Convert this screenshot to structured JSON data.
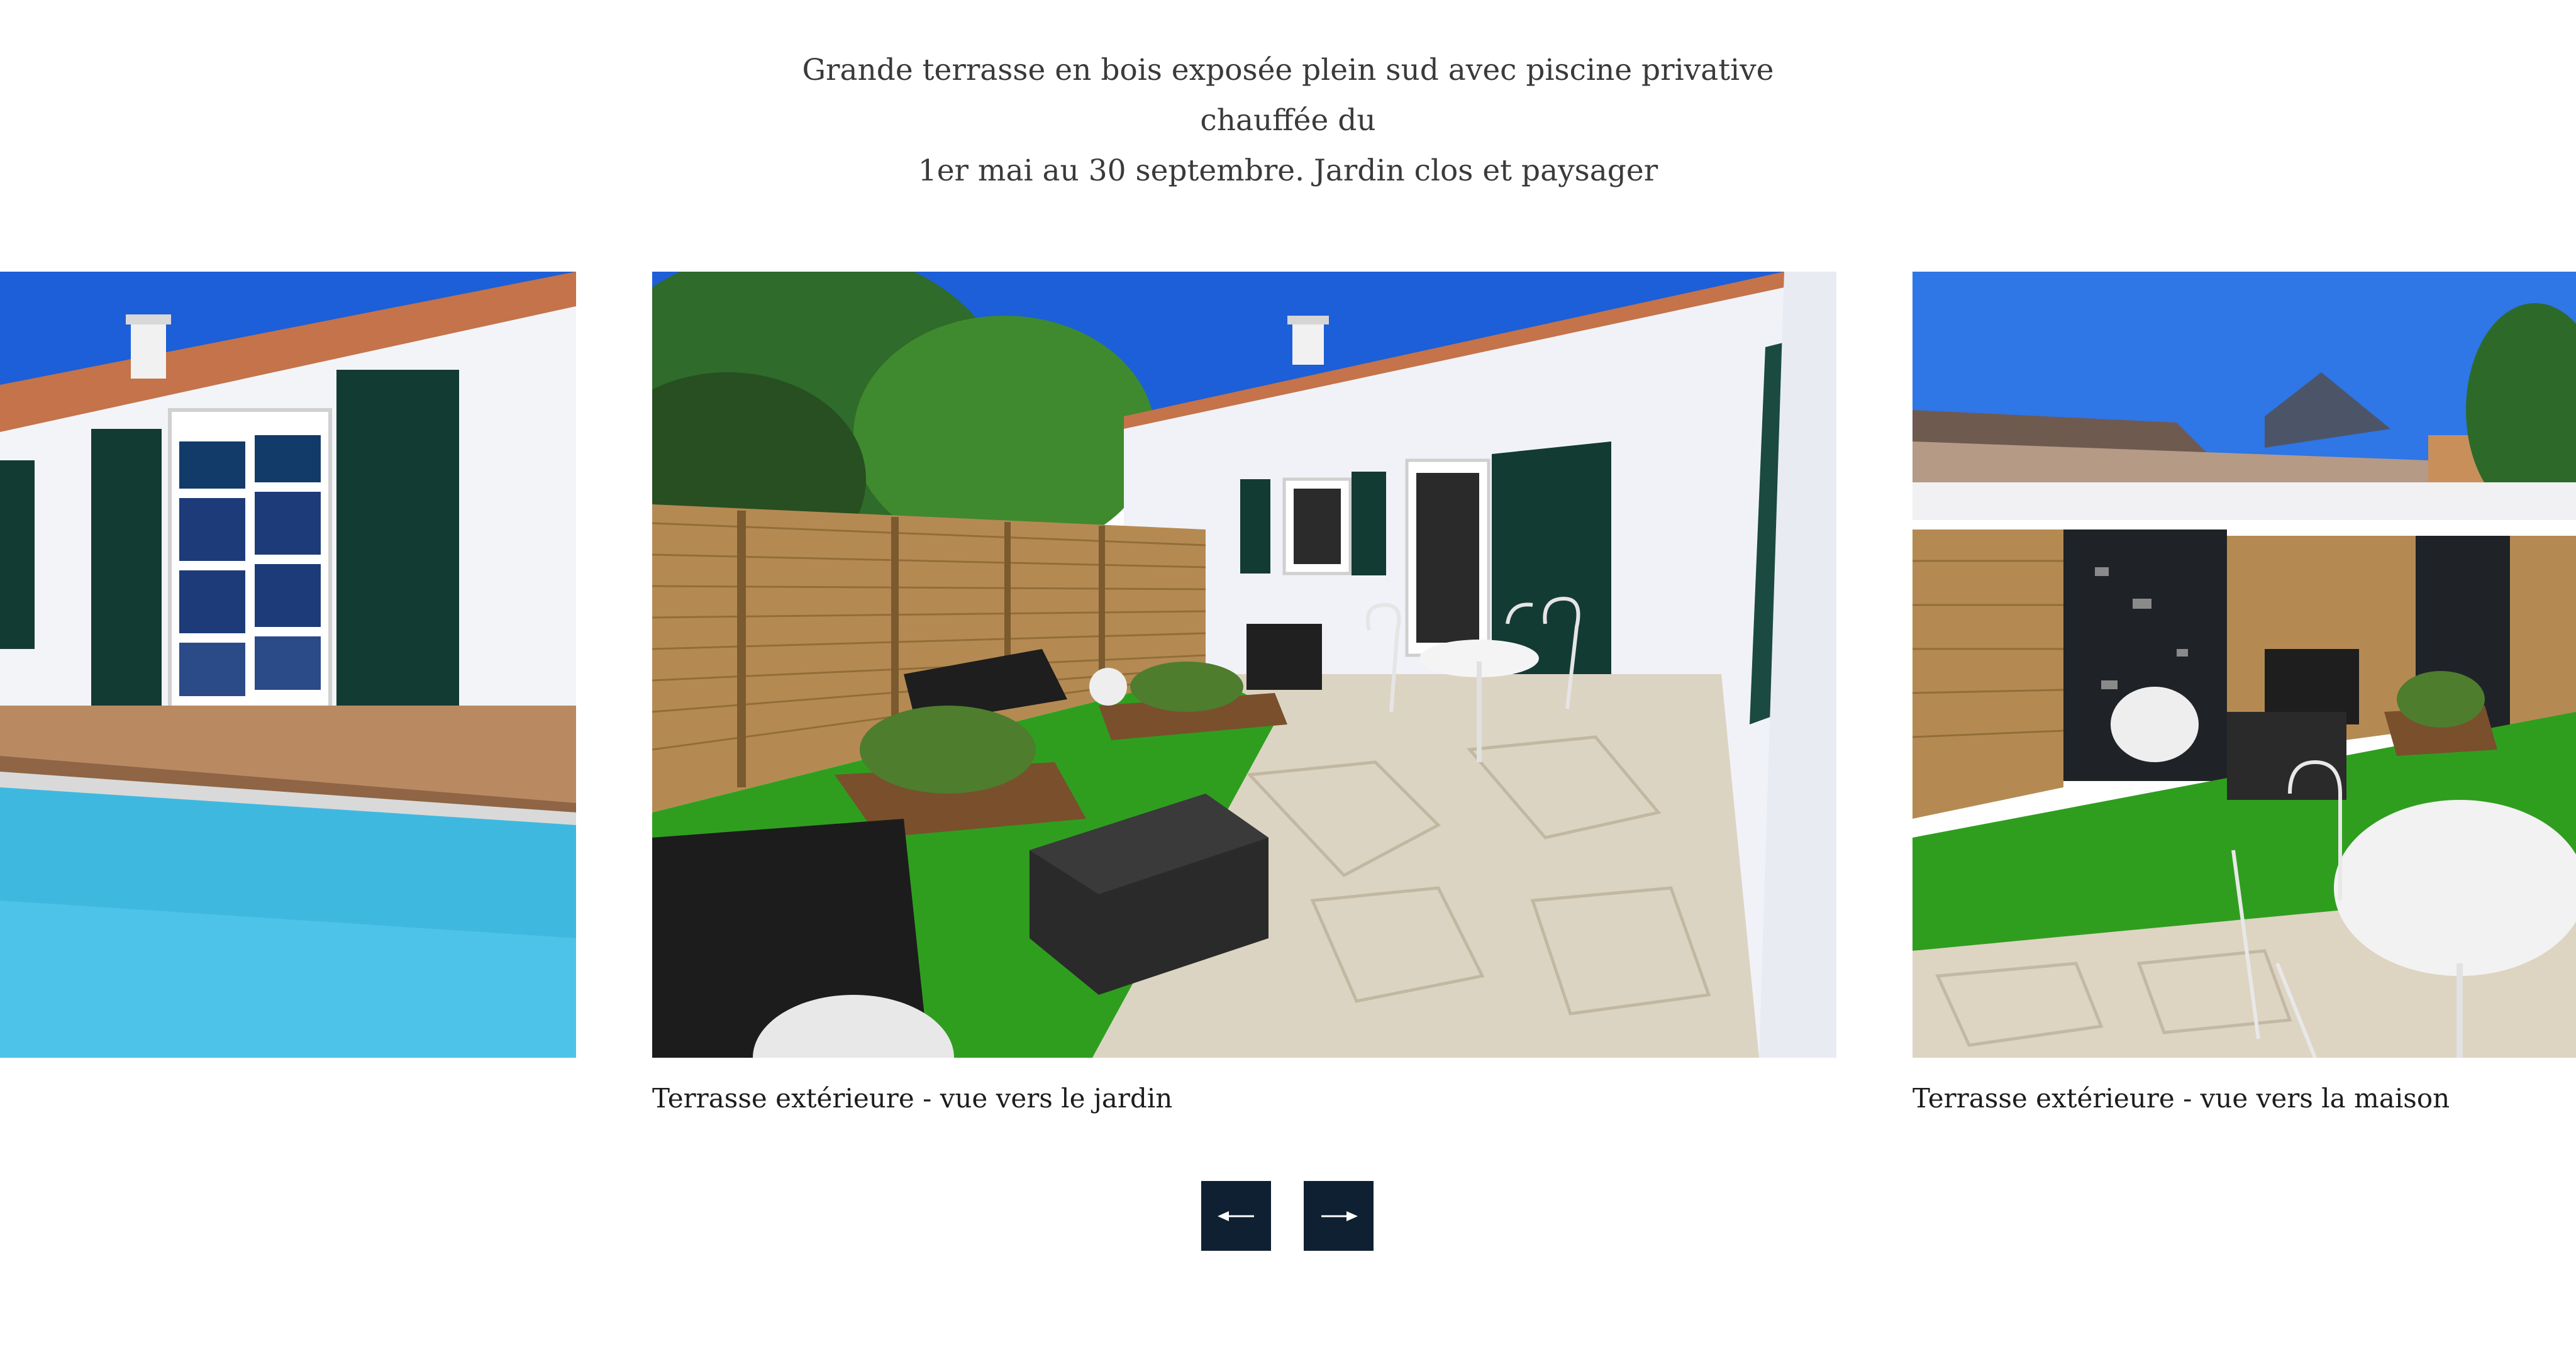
{
  "intro": {
    "line1": "Grande terrasse en bois exposée plein sud avec piscine privative chauffée du",
    "line2": "1er mai au 30 septembre. Jardin clos et paysager"
  },
  "carousel": {
    "slides": [
      {
        "caption": ""
      },
      {
        "caption": "Terrasse extérieure - vue vers le jardin"
      },
      {
        "caption": "Terrasse extérieure - vue vers la maison"
      }
    ],
    "prev_icon": "arrow-left-icon",
    "next_icon": "arrow-right-icon"
  },
  "colors": {
    "nav_button_bg": "#0e2031",
    "text": "#3a3a3a",
    "sky": "#1c5fd8",
    "pool": "#3fb8e0",
    "lawn": "#2f9e1f",
    "wood": "#b58a52",
    "shutter": "#123b33"
  }
}
